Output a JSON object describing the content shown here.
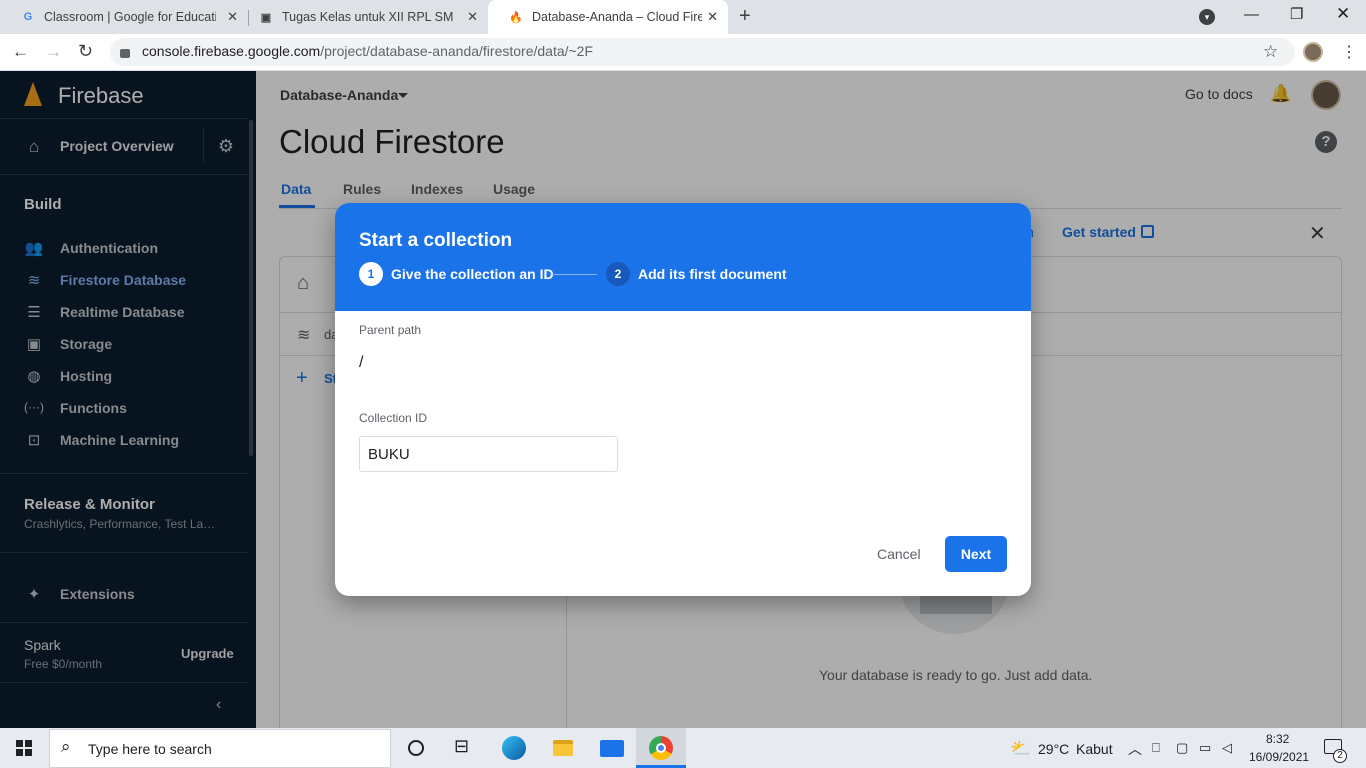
{
  "browser": {
    "tabs": [
      {
        "title": "Classroom | Google for Education",
        "favicon": "G"
      },
      {
        "title": "Tugas Kelas untuk XII RPL SMK Ti",
        "favicon": "▣"
      },
      {
        "title": "Database-Ananda – Cloud Firestore",
        "favicon": "🔥"
      }
    ],
    "url_host": "console.firebase.google.com",
    "url_path": "/project/database-ananda/firestore/data/~2F",
    "new_tab": "+"
  },
  "sidebar": {
    "brand": "Firebase",
    "project_overview": "Project Overview",
    "build_heading": "Build",
    "items": [
      {
        "label": "Authentication",
        "icon": "people-icon"
      },
      {
        "label": "Firestore Database",
        "icon": "firestore-icon"
      },
      {
        "label": "Realtime Database",
        "icon": "database-icon"
      },
      {
        "label": "Storage",
        "icon": "storage-icon"
      },
      {
        "label": "Hosting",
        "icon": "globe-icon"
      },
      {
        "label": "Functions",
        "icon": "functions-icon"
      },
      {
        "label": "Machine Learning",
        "icon": "robot-icon"
      }
    ],
    "release_heading": "Release & Monitor",
    "release_sub": "Crashlytics, Performance, Test La…",
    "extensions": "Extensions",
    "plan": "Spark",
    "plan_sub": "Free $0/month",
    "upgrade": "Upgrade"
  },
  "header": {
    "project_name": "Database-Ananda",
    "go_to_docs": "Go to docs",
    "page_title": "Cloud Firestore",
    "tabs": [
      "Data",
      "Rules",
      "Indexes",
      "Usage"
    ],
    "get_started": "Get started",
    "banner_partial": "n"
  },
  "panel": {
    "root_partial": "da",
    "start_partial": "St",
    "empty_text": "Your database is ready to go. Just add data."
  },
  "dialog": {
    "title": "Start a collection",
    "step1_num": "1",
    "step1_label": "Give the collection an ID",
    "step2_num": "2",
    "step2_label": "Add its first document",
    "parent_path_label": "Parent path",
    "parent_path_value": "/",
    "collection_id_label": "Collection ID",
    "collection_id_value": "BUKU",
    "cancel": "Cancel",
    "next": "Next"
  },
  "taskbar": {
    "search_placeholder": "Type here to search",
    "weather_temp": "29°C",
    "weather_desc": "Kabut",
    "time": "8:32",
    "date": "16/09/2021",
    "notif_count": "2"
  },
  "colors": {
    "firebase_blue": "#1a73e8",
    "sidebar_bg": "#0b1c2d",
    "active_nav": "#8ab4f8"
  }
}
